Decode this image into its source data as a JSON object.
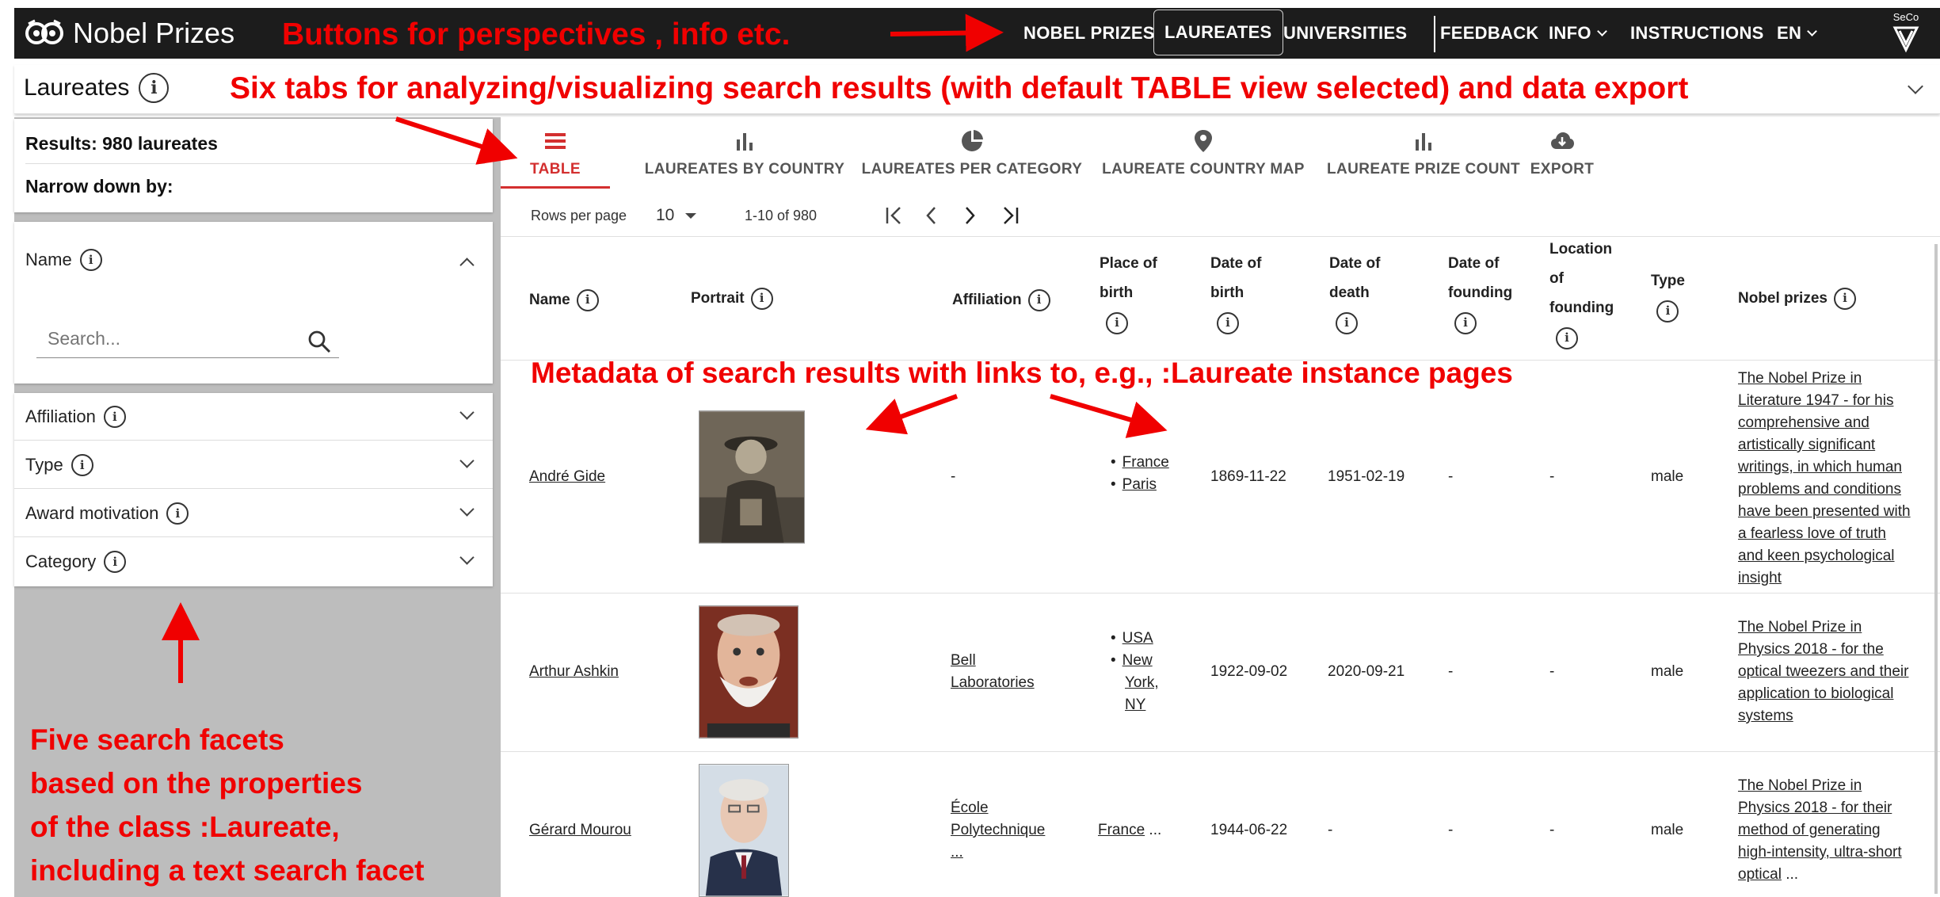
{
  "topbar": {
    "brand": "Nobel Prizes",
    "nav": [
      "NOBEL PRIZES",
      "LAUREATES",
      "UNIVERSITIES",
      "FEEDBACK",
      "INFO",
      "INSTRUCTIONS",
      "EN"
    ],
    "active_nav": "LAUREATES",
    "seco_text": "SeCo"
  },
  "perspective": {
    "title": "Laureates"
  },
  "facets": {
    "results": "Results: 980 laureates",
    "narrow": "Narrow down by:",
    "name_label": "Name",
    "search_placeholder": "Search...",
    "items": [
      "Affiliation",
      "Type",
      "Award motivation",
      "Category"
    ]
  },
  "tabs": [
    {
      "label": "TABLE",
      "icon": "list-icon"
    },
    {
      "label": "LAUREATES BY COUNTRY",
      "icon": "bar-chart-icon"
    },
    {
      "label": "LAUREATES PER CATEGORY",
      "icon": "pie-chart-icon"
    },
    {
      "label": "LAUREATE COUNTRY MAP",
      "icon": "map-pin-icon"
    },
    {
      "label": "LAUREATE PRIZE COUNT",
      "icon": "bar-chart-icon"
    },
    {
      "label": "EXPORT",
      "icon": "cloud-download-icon"
    }
  ],
  "active_tab": "TABLE",
  "pagination": {
    "rows_label": "Rows per page",
    "rows_value": "10",
    "range": "1-10 of 980"
  },
  "table": {
    "headers": {
      "name": "Name",
      "portrait": "Portrait",
      "affiliation": "Affiliation",
      "place_of_birth": [
        "Place of",
        "birth"
      ],
      "date_of_birth": [
        "Date of",
        "birth"
      ],
      "date_of_death": [
        "Date of",
        "death"
      ],
      "date_of_founding": [
        "Date of",
        "founding"
      ],
      "location_of_founding": [
        "Location",
        "of",
        "founding"
      ],
      "type": "Type",
      "nobel_prizes": "Nobel prizes"
    },
    "rows": [
      {
        "name": "André Gide",
        "affiliation": [
          "-"
        ],
        "place": [
          "France",
          "Paris"
        ],
        "birth": "1869-11-22",
        "death": "1951-02-19",
        "founding": "-",
        "location": "-",
        "type": "male",
        "prize": [
          "The Nobel Prize in",
          "Literature 1947 - for his",
          "comprehensive and",
          "artistically significant",
          "writings, in which human",
          "problems and conditions",
          "have been presented with",
          "a fearless love of truth",
          "and keen psychological",
          "insight"
        ]
      },
      {
        "name": "Arthur Ashkin",
        "affiliation": [
          "Bell",
          "Laboratories"
        ],
        "place": [
          "USA",
          "New",
          "York,",
          "NY"
        ],
        "birth": "1922-09-02",
        "death": "2020-09-21",
        "founding": "-",
        "location": "-",
        "type": "male",
        "prize": [
          "The Nobel Prize in",
          "Physics 2018 - for the",
          "optical tweezers and their",
          "application to biological",
          "systems"
        ]
      },
      {
        "name": "Gérard Mourou",
        "affiliation": [
          "École",
          "Polytechnique",
          "..."
        ],
        "place_link": "France",
        "place_more": " ...",
        "birth": "1944-06-22",
        "death": "-",
        "founding": "-",
        "location": "-",
        "type": "male",
        "prize": [
          "The Nobel Prize in",
          "Physics 2018 - for their",
          "method of generating",
          "high-intensity, ultra-short",
          "optical"
        ],
        "prize_more": " ..."
      }
    ]
  },
  "annotations": {
    "nav": "Buttons for perspectives , info etc.",
    "tabs": "Six tabs for analyzing/visualizing search results (with default TABLE view selected) and data export",
    "meta": "Metadata of search results with links to, e.g., :Laureate instance pages",
    "facets": [
      "Five search facets",
      "based on the properties",
      "of the class :Laureate,",
      "including a text search facet"
    ]
  },
  "colors": {
    "annotation": "#f00000",
    "active_tab": "#d32f2f",
    "topbar": "#1c1c1c",
    "facet_bg": "#bdbdbd"
  }
}
